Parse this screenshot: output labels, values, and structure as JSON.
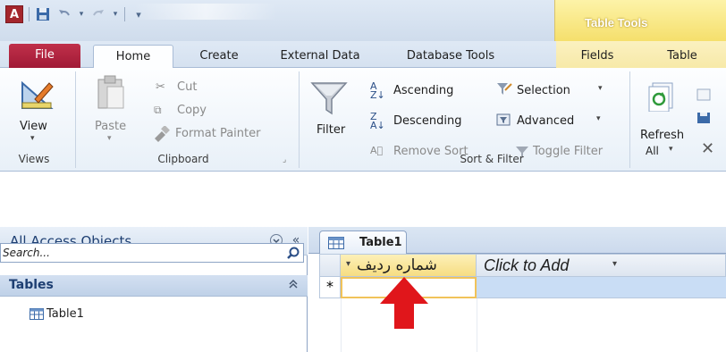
{
  "app": {
    "icon_letter": "A",
    "contextual_group": "Table Tools"
  },
  "qat": {
    "save_icon": "save-icon",
    "undo_icon": "undo-icon",
    "redo_icon": "redo-icon"
  },
  "tabs": [
    {
      "label": "File"
    },
    {
      "label": "Home"
    },
    {
      "label": "Create"
    },
    {
      "label": "External Data"
    },
    {
      "label": "Database Tools"
    },
    {
      "label": "Fields"
    },
    {
      "label": "Table"
    }
  ],
  "ribbon": {
    "views": {
      "view_label": "View",
      "group_label": "Views"
    },
    "clipboard": {
      "paste_label": "Paste",
      "cut_label": "Cut",
      "copy_label": "Copy",
      "format_painter_label": "Format Painter",
      "group_label": "Clipboard"
    },
    "sort_filter": {
      "filter_label": "Filter",
      "ascending_label": "Ascending",
      "descending_label": "Descending",
      "remove_sort_label": "Remove Sort",
      "selection_label": "Selection",
      "advanced_label": "Advanced",
      "toggle_filter_label": "Toggle Filter",
      "group_label": "Sort & Filter"
    },
    "records": {
      "refresh_label": "Refresh",
      "refresh_sub": "All"
    }
  },
  "nav": {
    "title": "All Access Objects",
    "search_placeholder": "Search...",
    "group_header": "Tables",
    "items": [
      {
        "label": "Table1"
      }
    ]
  },
  "document": {
    "tab_label": "Table1"
  },
  "datasheet": {
    "columns": [
      {
        "label": "شماره ردیف"
      },
      {
        "label": "Click to Add"
      }
    ],
    "new_record_marker": "*"
  },
  "colors": {
    "file_tab": "#a11a36",
    "contextual": "#f5df6c",
    "selected_column": "#f6dd82",
    "arrow": "#e0161b"
  }
}
